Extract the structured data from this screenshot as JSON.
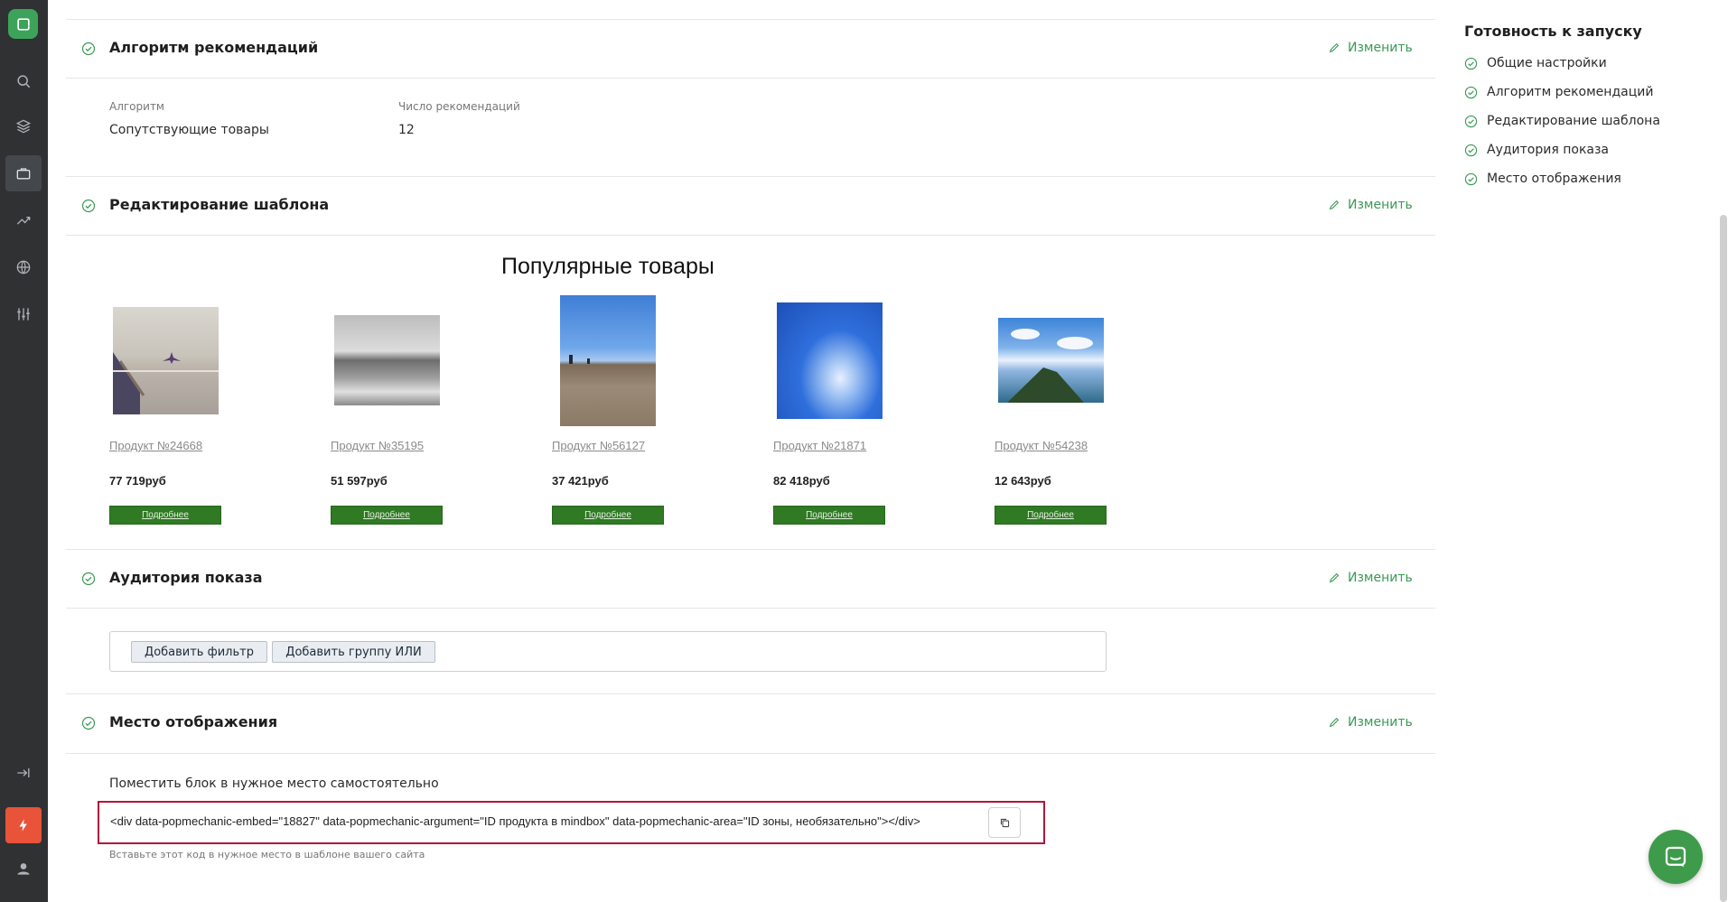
{
  "sections": {
    "algorithm": {
      "title": "Алгоритм рекомендаций",
      "edit_label": "Изменить",
      "fields": [
        {
          "label": "Алгоритм",
          "value": "Сопутствующие товары"
        },
        {
          "label": "Число рекомендаций",
          "value": "12"
        }
      ]
    },
    "template": {
      "title": "Редактирование шаблона",
      "edit_label": "Изменить",
      "preview_title": "Популярные товары",
      "products": [
        {
          "name": "Продукт №24668",
          "price": "77 719руб",
          "button": "Подробнее",
          "image": "pier-photo"
        },
        {
          "name": "Продукт №35195",
          "price": "51 597руб",
          "button": "Подробнее",
          "image": "grayscale-beach-photo"
        },
        {
          "name": "Продукт №56127",
          "price": "37 421руб",
          "button": "Подробнее",
          "image": "sand-sky-photo"
        },
        {
          "name": "Продукт №21871",
          "price": "82 418руб",
          "button": "Подробнее",
          "image": "blue-sky-cloud-photo"
        },
        {
          "name": "Продукт №54238",
          "price": "12 643руб",
          "button": "Подробнее",
          "image": "hill-clouds-photo"
        }
      ]
    },
    "audience": {
      "title": "Аудитория показа",
      "edit_label": "Изменить",
      "add_filter": "Добавить фильтр",
      "add_or_group": "Добавить группу ИЛИ"
    },
    "placement": {
      "title": "Место отображения",
      "edit_label": "Изменить",
      "subtitle": "Поместить блок в нужное место самостоятельно",
      "code": "<div data-popmechanic-embed=\"18827\" data-popmechanic-argument=\"ID продукта в mindbox\" data-popmechanic-area=\"ID зоны, необязательно\"></div>",
      "hint": "Вставьте этот код в нужное место в шаблоне вашего сайта"
    }
  },
  "readiness": {
    "title": "Готовность к запуску",
    "items": [
      "Общие настройки",
      "Алгоритм рекомендаций",
      "Редактирование шаблона",
      "Аудитория показа",
      "Место отображения"
    ]
  },
  "sidebar": {
    "icons": [
      "search-icon",
      "layers-icon",
      "briefcase-icon",
      "trend-icon",
      "globe-icon",
      "sliders-icon",
      "logout-icon",
      "bolt-icon",
      "user-icon"
    ]
  },
  "colors": {
    "accent": "#3a9a55",
    "sidebar": "#2f3133",
    "product_button": "#2f7a23",
    "highlight_border": "#b1163a",
    "bolt": "#e8533a"
  }
}
